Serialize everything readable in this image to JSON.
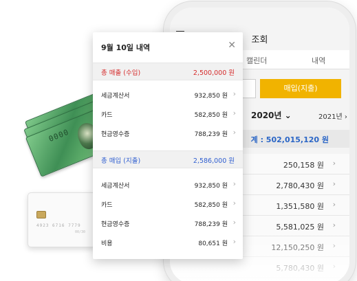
{
  "card": {
    "number": "4923 6716 7779",
    "expiry": "00/30"
  },
  "cash": {
    "note_number": "0000"
  },
  "phone": {
    "title": "조회",
    "tabs": [
      "캘린더",
      "내역"
    ],
    "segment": {
      "active_label": "매입(지출)"
    },
    "year": {
      "current": "2020년",
      "next": "2021년"
    },
    "total": "계 : 502,015,120 원",
    "rows": [
      "250,158 원",
      "2,780,430 원",
      "1,351,580 원",
      "5,581,025 원",
      "12,150,250 원",
      "5,780,430 원"
    ],
    "accent": "#f1b300"
  },
  "popup": {
    "title": "9월 10일 내역",
    "sales": {
      "label": "총 매출 (수입)",
      "value": "2,500,000 원",
      "items": [
        {
          "name": "세금계산서",
          "amount": "932,850 원"
        },
        {
          "name": "카드",
          "amount": "582,850 원"
        },
        {
          "name": "현금영수증",
          "amount": "788,239 원"
        }
      ],
      "color": "#d52b2b"
    },
    "purchase": {
      "label": "총 매입 (지출)",
      "value": "2,586,000 원",
      "items": [
        {
          "name": "세금계산서",
          "amount": "932,850 원"
        },
        {
          "name": "카드",
          "amount": "582,850 원"
        },
        {
          "name": "현금영수증",
          "amount": "788,239 원"
        },
        {
          "name": "비용",
          "amount": "80,651 원"
        }
      ],
      "color": "#2f5ed0"
    }
  }
}
